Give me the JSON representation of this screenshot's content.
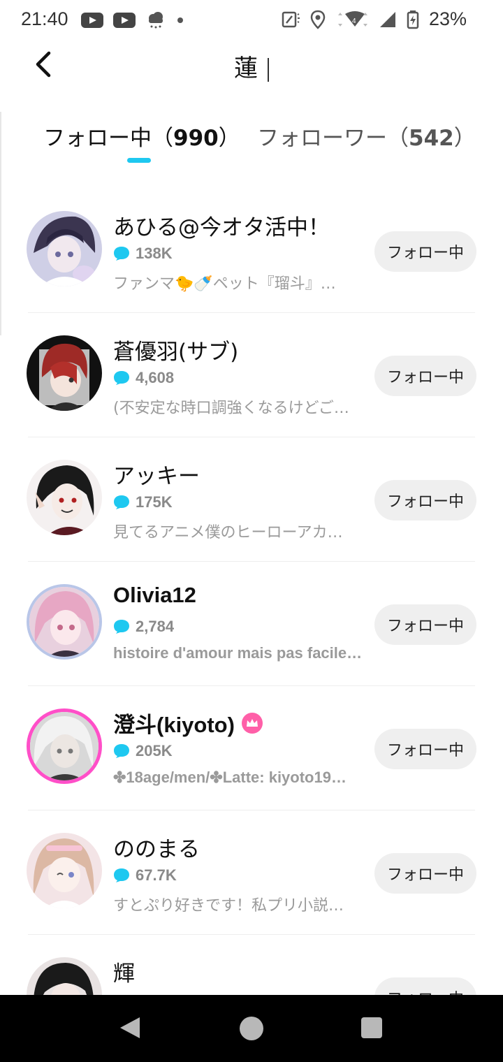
{
  "status_bar": {
    "time": "21:40",
    "battery": "23%",
    "icons": [
      "youtube-icon",
      "youtube-icon",
      "weather-icon",
      "dot-icon",
      "nfc-icon",
      "location-icon",
      "wifi-icon",
      "signal-icon",
      "battery-icon"
    ]
  },
  "header": {
    "title": "蓮"
  },
  "tabs": [
    {
      "label": "フォロー中（",
      "count": "990",
      "close": "）",
      "active": true
    },
    {
      "label": "フォローワー（",
      "count": "542",
      "close": "）",
      "active": false
    }
  ],
  "users": [
    {
      "name": "あひる@今オタ活中！",
      "count": "138K",
      "bio": "ファンマ🐤🍼ペット『瑠斗』…",
      "button": "フォロー中"
    },
    {
      "name": "蒼優羽(サブ)",
      "count": "4,608",
      "bio": "(不安定な時口調強くなるけどご…",
      "button": "フォロー中"
    },
    {
      "name": "アッキー",
      "count": "175K",
      "bio": "見てるアニメ僕のヒーローアカ…",
      "button": "フォロー中"
    },
    {
      "name": "Olivia12",
      "count": "2,784",
      "bio": "histoire d'amour mais pas facile…",
      "button": "フォロー中"
    },
    {
      "name": "澄斗(kiyoto)",
      "count": "205K",
      "bio": "✤18age/men/✤Latte: kiyoto19…",
      "button": "フォロー中"
    },
    {
      "name": "ののまる",
      "count": "67.7K",
      "bio": "すとぷり好きです！私プリ小説…",
      "button": "フォロー中"
    },
    {
      "name": "輝",
      "count": "",
      "bio": "",
      "button": "フォロー中"
    }
  ],
  "colors": {
    "accent": "#1ec8f0",
    "button_bg": "#efefef",
    "crown": "#ff5fa8"
  }
}
